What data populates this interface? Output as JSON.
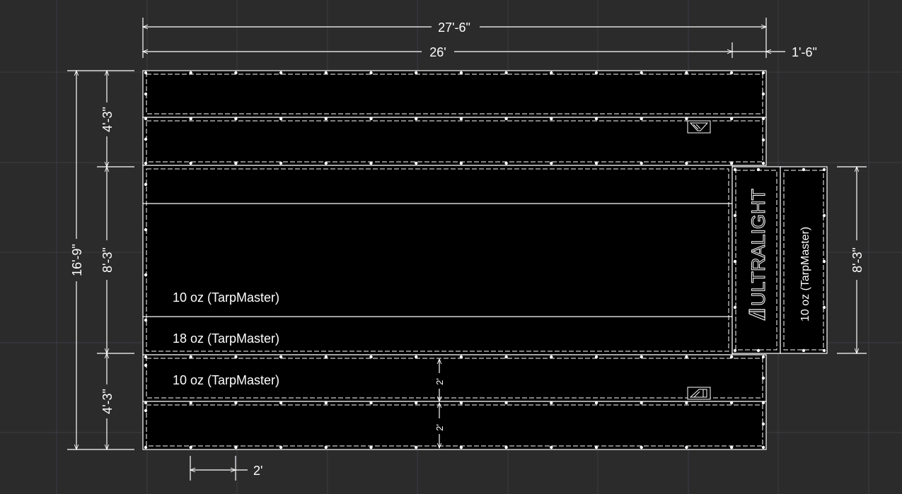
{
  "dimensions": {
    "overall_width": "27'-6\"",
    "main_width": "26'",
    "flap_width": "1'-6\"",
    "overall_height": "16'-9\"",
    "top_section_height": "4'-3\"",
    "middle_section_height": "8'-3\"",
    "bottom_section_height": "4'-3\"",
    "flap_height": "8'-3\"",
    "panel_height_upper": "2'",
    "panel_height_lower": "2'",
    "grommet_spacing": "2'"
  },
  "labels": {
    "middle_panel": "10 oz (TarpMaster)",
    "middle_strip": "18 oz (TarpMaster)",
    "bottom_panel": "10 oz (TarpMaster)",
    "flap_panel": "10 oz (TarpMaster)",
    "brand": "ULTRALIGHT"
  },
  "colors": {
    "background": "#2b2b2b",
    "grid": "#3b3b45",
    "panel_fill": "#000000",
    "line": "#ffffff"
  }
}
